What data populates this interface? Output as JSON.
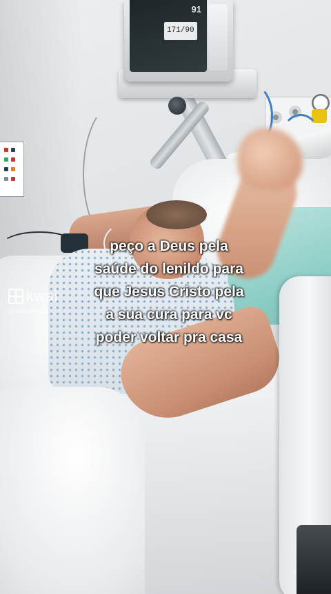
{
  "caption": {
    "lines": [
      "peço a Deus pela",
      "saúde do lenildo para",
      "que Jesus Cristo pela",
      "a sua cura para vc",
      "poder voltar pra casa"
    ]
  },
  "watermark": {
    "brand": "kwai",
    "handle": "@NeideOficial"
  },
  "monitor": {
    "heart_rate": "91",
    "blood_pressure": "171/90"
  },
  "colors": {
    "caption_text": "#ffffff",
    "pillow_teal": "#8fcfc7",
    "valve_yellow": "#e9c211",
    "cable_blue": "#3d7fc1"
  }
}
